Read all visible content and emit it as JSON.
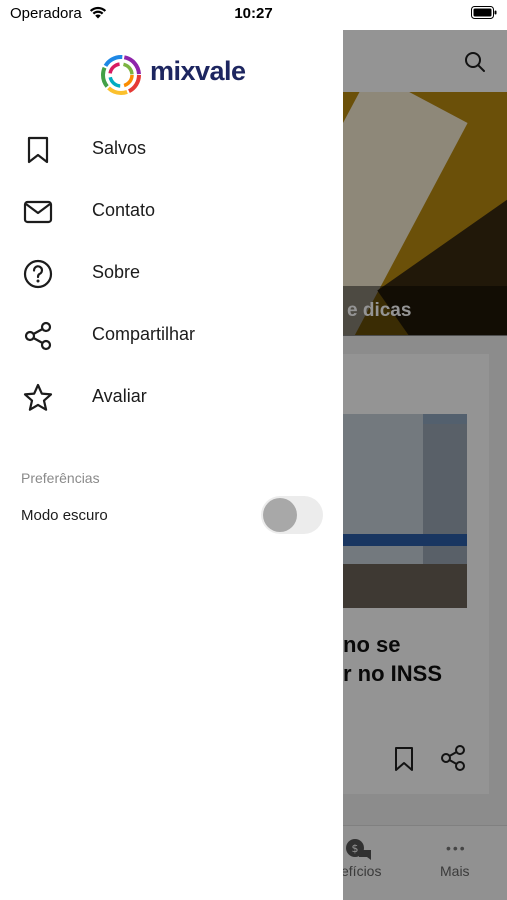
{
  "status_bar": {
    "carrier": "Operadora",
    "time": "10:27"
  },
  "drawer": {
    "logo_text": "mixvale",
    "menu": [
      {
        "label": "Salvos",
        "icon": "bookmark-icon"
      },
      {
        "label": "Contato",
        "icon": "mail-icon"
      },
      {
        "label": "Sobre",
        "icon": "help-circle-icon"
      },
      {
        "label": "Compartilhar",
        "icon": "share-icon"
      },
      {
        "label": "Avaliar",
        "icon": "star-icon"
      }
    ],
    "preferences": {
      "title": "Preferências",
      "dark_mode_label": "Modo escuro",
      "dark_mode_on": false
    }
  },
  "background": {
    "hero_title": "e dicas",
    "article_title_line1": "no se",
    "article_title_line2": "r no INSS",
    "tab_benefits": "efícios",
    "tab_more": "Mais"
  },
  "colors": {
    "logo_text": "#1d2660",
    "overlay": "rgba(0,0,0,0.42)",
    "toggle_off_track": "#ececec",
    "toggle_off_knob": "#a8a8a8"
  }
}
